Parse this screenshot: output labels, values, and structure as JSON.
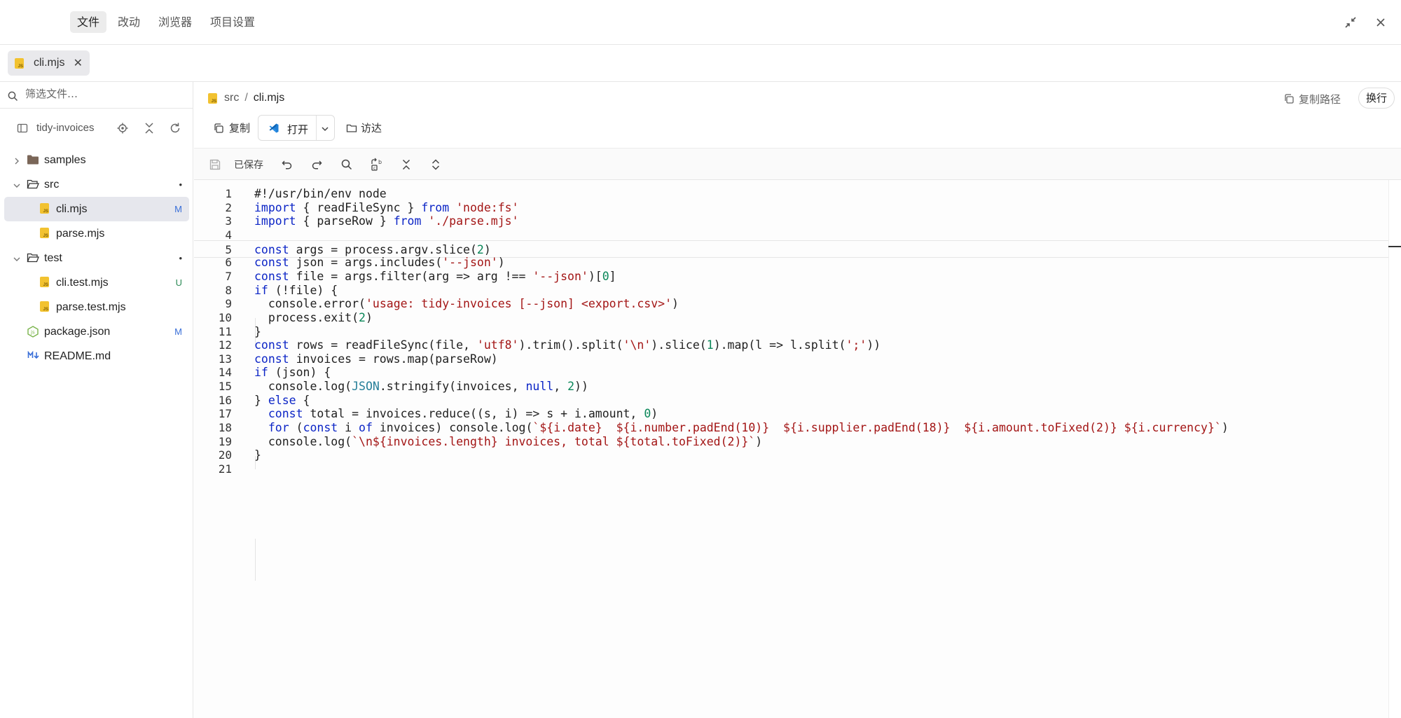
{
  "menu": {
    "items": [
      "文件",
      "改动",
      "浏览器",
      "项目设置"
    ],
    "active_index": 0
  },
  "window": {
    "collapse_icon": "collapse-arrows-icon",
    "close_icon": "close-icon"
  },
  "tabs": [
    {
      "label": "cli.mjs",
      "icon": "js-file-icon",
      "close": "✕"
    }
  ],
  "sidebar": {
    "filter_placeholder": "筛选文件…",
    "project_name": "tidy-invoices",
    "tree": [
      {
        "name": "samples",
        "type": "folder",
        "expanded": false,
        "depth": 0,
        "badge": ""
      },
      {
        "name": "src",
        "type": "folder",
        "expanded": true,
        "depth": 0,
        "badge": "•"
      },
      {
        "name": "cli.mjs",
        "type": "js",
        "depth": 1,
        "badge": "M",
        "selected": true
      },
      {
        "name": "parse.mjs",
        "type": "js",
        "depth": 1,
        "badge": ""
      },
      {
        "name": "test",
        "type": "folder",
        "expanded": true,
        "depth": 0,
        "badge": "•"
      },
      {
        "name": "cli.test.mjs",
        "type": "js",
        "depth": 1,
        "badge": "U"
      },
      {
        "name": "parse.test.mjs",
        "type": "js",
        "depth": 1,
        "badge": ""
      },
      {
        "name": "package.json",
        "type": "node",
        "depth": 0,
        "badge": "M"
      },
      {
        "name": "README.md",
        "type": "md",
        "depth": 0,
        "badge": ""
      }
    ]
  },
  "editor": {
    "breadcrumb": [
      "src",
      "cli.mjs"
    ],
    "breadcrumb_sep": "/",
    "copy_path_label": "复制路径",
    "wrap_label": "换行",
    "copy_label": "复制",
    "open_label": "打开",
    "finder_label": "访达",
    "saved_label": "已保存",
    "current_line": 5,
    "lines": [
      "#!/usr/bin/env node",
      "import { readFileSync } from 'node:fs'",
      "import { parseRow } from './parse.mjs'",
      "",
      "const args = process.argv.slice(2)",
      "const json = args.includes('--json')",
      "const file = args.filter(arg => arg !== '--json')[0]",
      "if (!file) {",
      "  console.error('usage: tidy-invoices [--json] <export.csv>')",
      "  process.exit(2)",
      "}",
      "const rows = readFileSync(file, 'utf8').trim().split('\\n').slice(1).map(l => l.split(';'))",
      "const invoices = rows.map(parseRow)",
      "if (json) {",
      "  console.log(JSON.stringify(invoices, null, 2))",
      "} else {",
      "  const total = invoices.reduce((s, i) => s + i.amount, 0)",
      "  for (const i of invoices) console.log(`${i.date}  ${i.number.padEnd(10)}  ${i.supplier.padEnd(18)}  ${i.amount.toFixed(2)} ${i.currency}`)",
      "  console.log(`\\n${invoices.length} invoices, total ${total.toFixed(2)}`)",
      "}",
      ""
    ]
  },
  "colors": {
    "accent_selected": "#e6e7ed",
    "keyword": "#0b24c6",
    "string": "#a31515",
    "number": "#098658",
    "modified": "#3a6fd8",
    "untracked": "#2e8b57",
    "js_icon": "#f2c230"
  }
}
